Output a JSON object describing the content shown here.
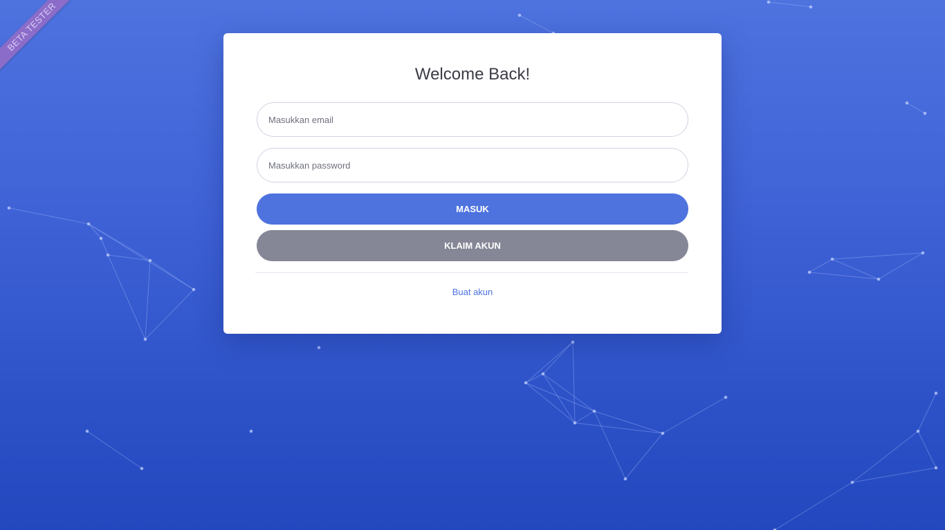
{
  "ribbon": {
    "label": "BETA TESTER"
  },
  "login": {
    "title": "Welcome Back!",
    "email_placeholder": "Masukkan email",
    "password_placeholder": "Masukkan password",
    "login_button": "MASUK",
    "claim_button": "KLAIM AKUN",
    "register_link": "Buat akun"
  },
  "colors": {
    "primary": "#4e73df",
    "secondary": "#858796",
    "background_top": "#4e73df",
    "background_bottom": "#2347be"
  }
}
